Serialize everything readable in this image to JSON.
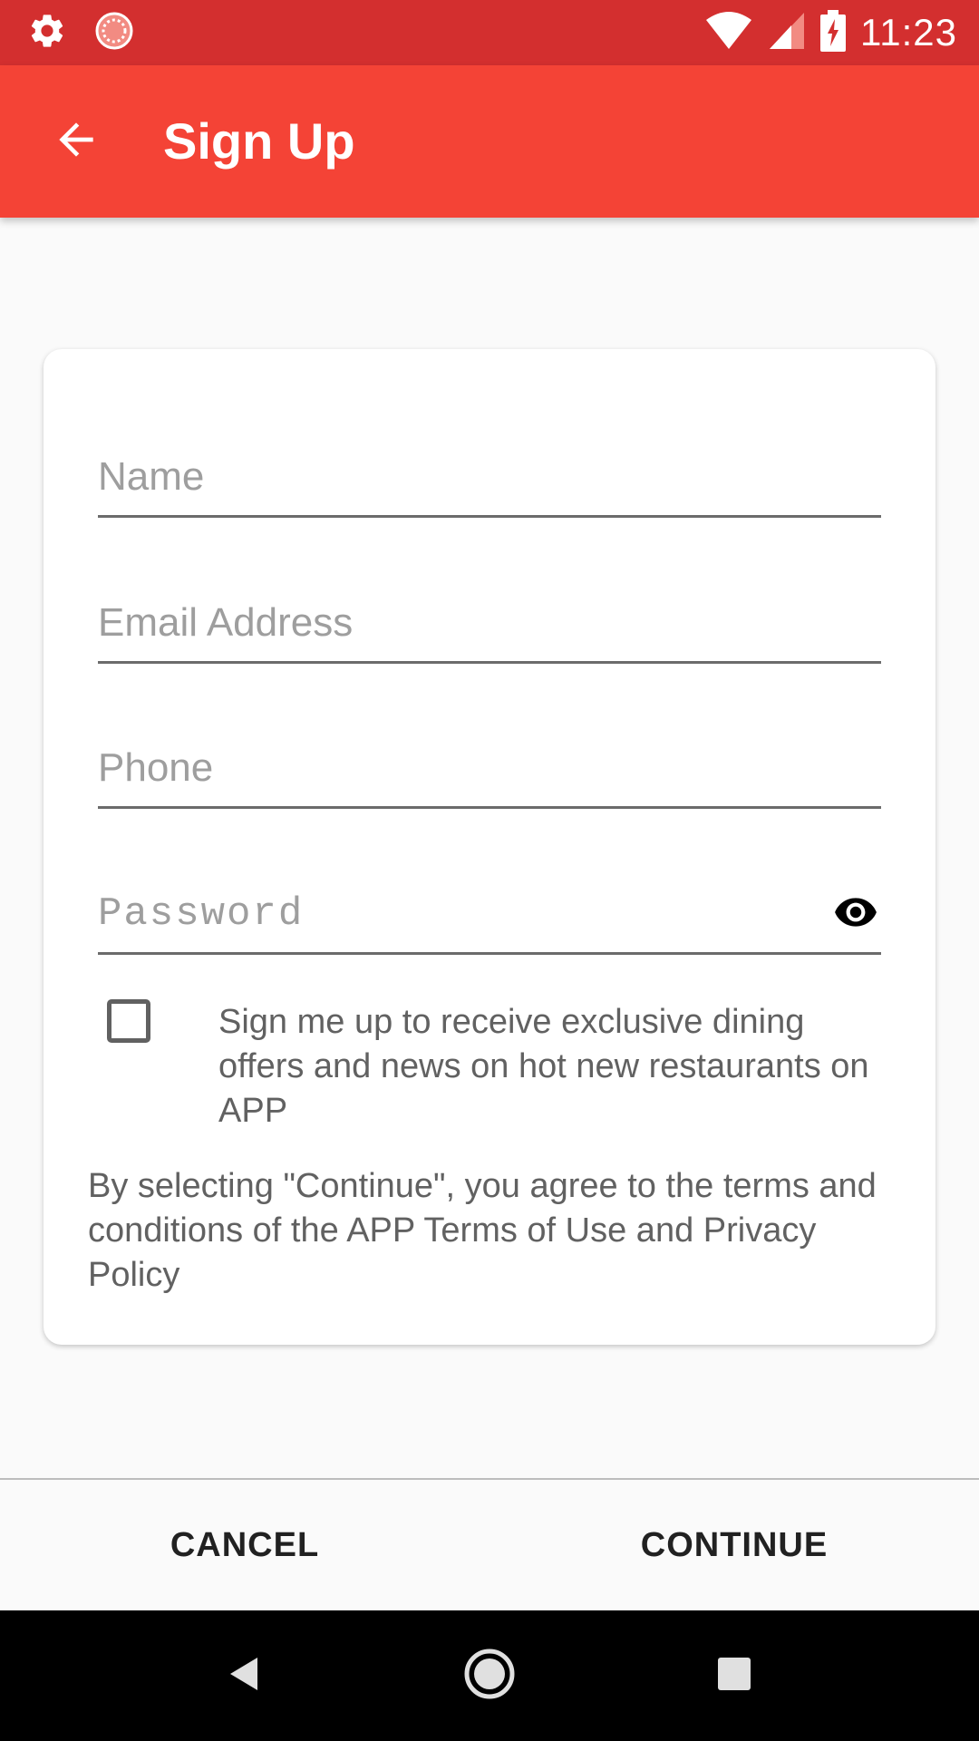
{
  "status_bar": {
    "time": "11:23",
    "left_icons": [
      "settings-icon",
      "loading-spinner-icon"
    ],
    "right_icons": [
      "wifi-icon",
      "cellular-signal-icon",
      "battery-charging-icon"
    ]
  },
  "app_bar": {
    "title": "Sign Up",
    "back_icon": "arrow-back-icon",
    "background": "#f44336",
    "status_background": "#d32f2f"
  },
  "form": {
    "name_placeholder": "Name",
    "email_placeholder": "Email Address",
    "phone_placeholder": "Phone",
    "password_placeholder": "Password",
    "password_toggle_icon": "eye-icon",
    "opt_in_checked": false,
    "opt_in_text": "Sign me up to receive exclusive dining offers and news on hot new restaurants on APP",
    "terms_text": "By selecting \"Continue\", you agree to the terms and conditions of the APP Terms of Use and Privacy Policy"
  },
  "actions": {
    "cancel_label": "CANCEL",
    "continue_label": "CONTINUE"
  },
  "nav_bar": {
    "icons": [
      "nav-back-icon",
      "nav-home-icon",
      "nav-recents-icon"
    ]
  }
}
